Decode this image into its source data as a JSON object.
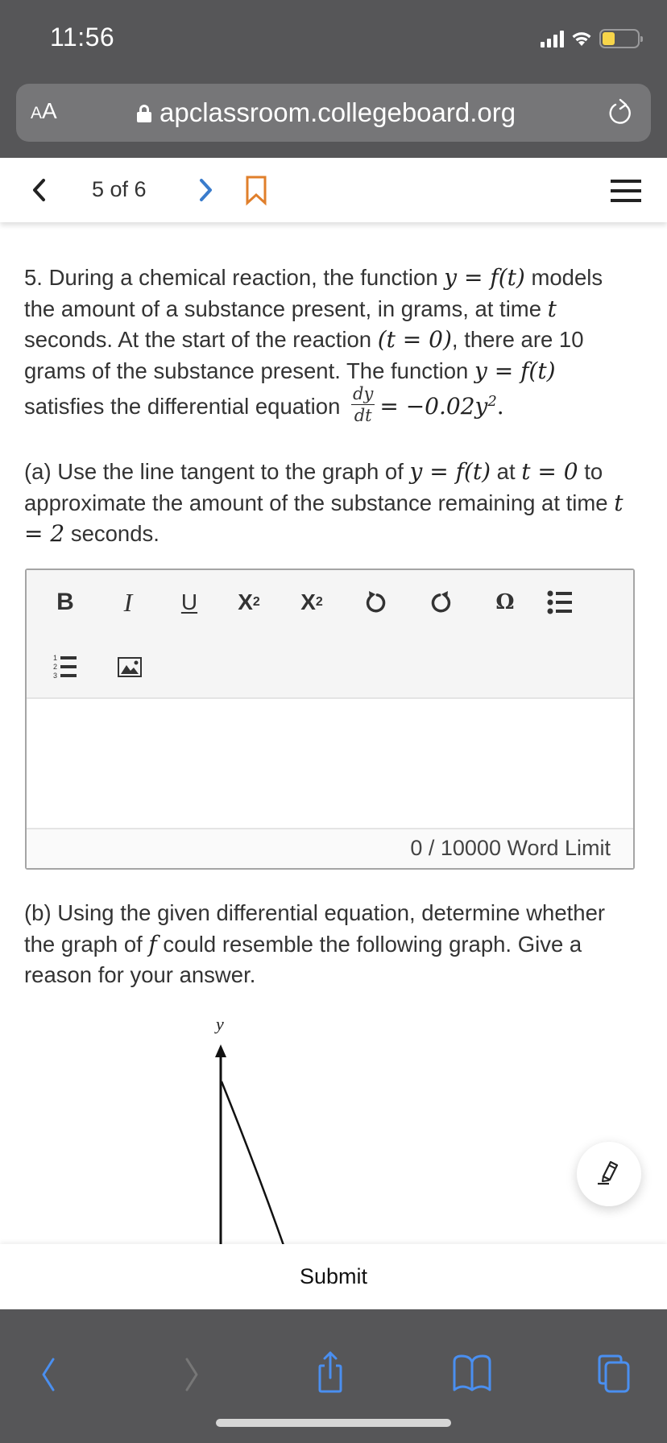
{
  "status_bar": {
    "time": "11:56",
    "icons": [
      "cellular-signal-icon",
      "wifi-icon",
      "battery-icon"
    ],
    "battery_level": 0.36,
    "battery_color": "#f7d54a"
  },
  "browser": {
    "text_size_label_small": "A",
    "text_size_label_large": "A",
    "url": "apclassroom.collegeboard.org",
    "secure": true,
    "reload_icon": "reload-icon"
  },
  "question_nav": {
    "prev_icon": "chevron-left-icon",
    "position_label": "5 of 6",
    "next_icon": "chevron-right-icon",
    "bookmark_icon": "bookmark-icon",
    "menu_icon": "hamburger-menu-icon",
    "accent_next": "#3a7ccc",
    "accent_bookmark": "#e07f2b"
  },
  "question": {
    "number": "5.",
    "intro": {
      "t1": " During a chemical reaction, the function ",
      "m1": "y = f(t)",
      "t2": " models the amount of a substance present, in grams, at time ",
      "m2": "t",
      "t3": " seconds. At the start of the reaction ",
      "m3": "(t = 0)",
      "t4": ", there are 10 grams of the substance present. The function ",
      "m4": "y = f(t)",
      "t5": " satisfies the differential equation ",
      "frac_num": "dy",
      "frac_den": "dt",
      "m5": "= −0.02y",
      "m5_exp": "2",
      "m5_end": "."
    },
    "part_a": {
      "t1": "(a) Use the line tangent to the graph of ",
      "m1": "y = f(t)",
      "t2": " at ",
      "m2": "t = 0",
      "t3": " to approximate the amount of the substance remaining at time ",
      "m3": "t = 2",
      "t4": " seconds."
    },
    "part_b": {
      "t1": "(b) Using the given differential equation, determine whether the graph of ",
      "m1": "f",
      "t2": " could resemble the following graph. Give a reason for your answer."
    }
  },
  "editor": {
    "toolbar": [
      {
        "name": "bold",
        "label": "B"
      },
      {
        "name": "italic",
        "label": "I"
      },
      {
        "name": "underline",
        "label": "U"
      },
      {
        "name": "superscript",
        "label": "X",
        "mark": "2"
      },
      {
        "name": "subscript",
        "label": "X",
        "mark": "2"
      },
      {
        "name": "undo",
        "icon": "undo-icon"
      },
      {
        "name": "redo",
        "icon": "redo-icon"
      },
      {
        "name": "special-character",
        "label": "Ω"
      },
      {
        "name": "bulleted-list",
        "icon": "bulleted-list-icon"
      },
      {
        "name": "numbered-list",
        "icon": "numbered-list-icon"
      },
      {
        "name": "insert-image",
        "icon": "image-icon"
      }
    ],
    "value": "",
    "word_count": "0",
    "word_limit_label": "0 / 10000 Word Limit"
  },
  "graph": {
    "axis_label_y": "y",
    "description": "decreasing concave-up curve starting on the y-axis"
  },
  "fab": {
    "icon": "pencil-highlighter-icon"
  },
  "submit": {
    "label": "Submit"
  },
  "browser_toolbar": {
    "items": [
      "back-icon",
      "forward-icon",
      "share-icon",
      "bookmarks-icon",
      "tabs-icon"
    ],
    "accent": "#4a8ff0"
  }
}
